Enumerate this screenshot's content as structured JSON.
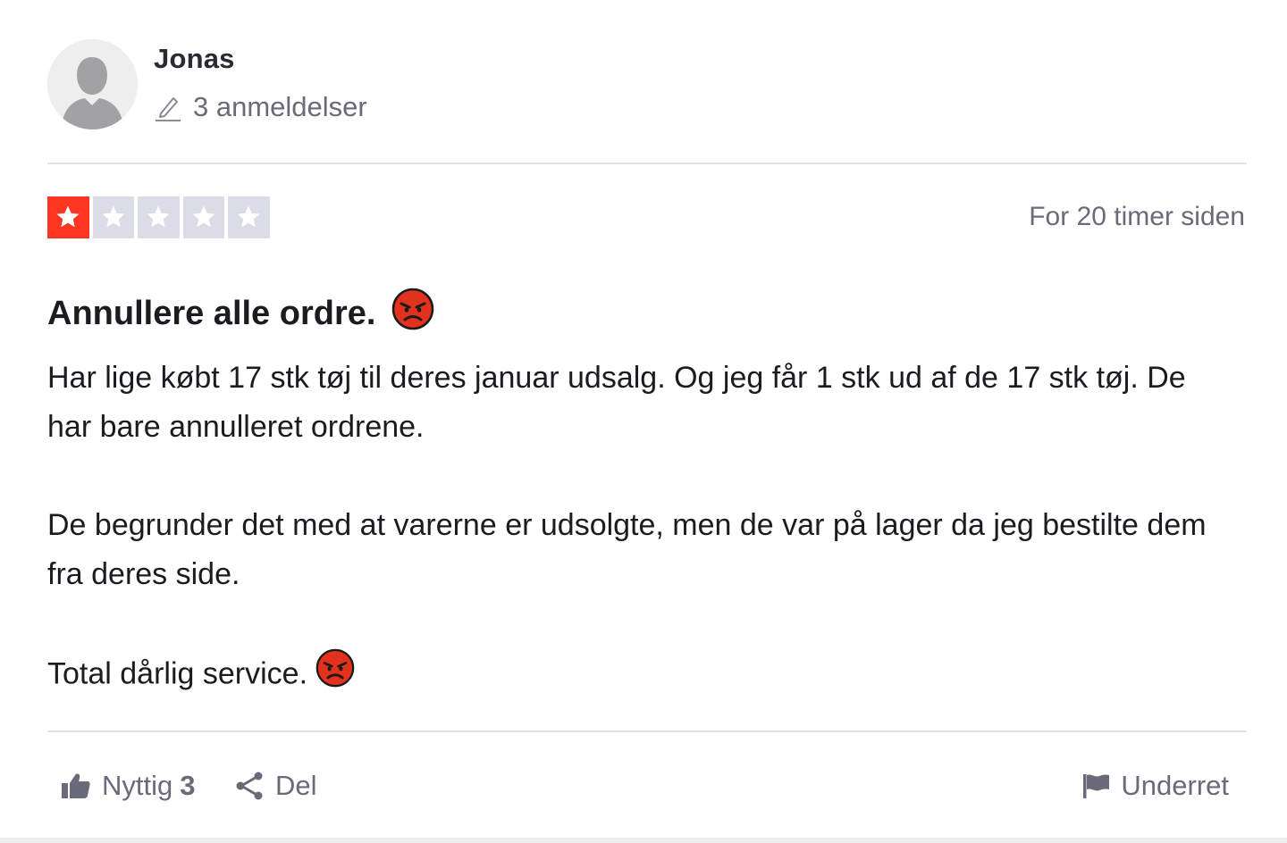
{
  "consumer": {
    "name": "Jonas",
    "review_count": "3 anmeldelser"
  },
  "review": {
    "rating": 1,
    "max_rating": 5,
    "date": "For 20 timer siden",
    "title": "Annullere alle ordre.",
    "paragraphs": [
      "Har lige købt 17 stk tøj til deres januar udsalg. Og jeg får 1 stk ud af de 17 stk tøj. De har bare annulleret ordrene.",
      "De begrunder det med at varerne er udsolgte, men de var på lager da jeg bestilte dem fra deres side.",
      "Total dårlig service."
    ]
  },
  "actions": {
    "useful_label": "Nyttig",
    "useful_count": "3",
    "share_label": "Del",
    "report_label": "Underret"
  },
  "icons": {
    "avatar": "user-silhouette-icon",
    "review_count": "pencil-icon",
    "star": "star-icon",
    "emoji": "angry-face-emoji",
    "useful": "thumbs-up-icon",
    "share": "share-icon",
    "report": "flag-icon"
  },
  "colors": {
    "star_filled": "#ff3722",
    "star_empty": "#dcdce6",
    "text_primary": "#1b1b21",
    "text_secondary": "#6a6a7a",
    "divider": "#e4e4e8"
  }
}
